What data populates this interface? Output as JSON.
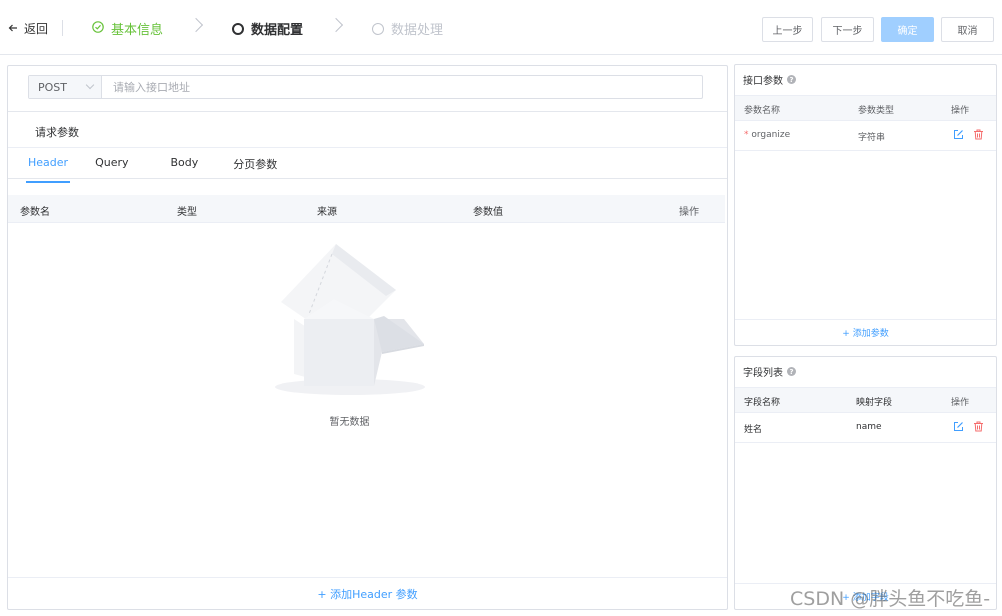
{
  "header": {
    "back_label": "返回",
    "steps": [
      {
        "label": "基本信息",
        "state": "done"
      },
      {
        "label": "数据配置",
        "state": "active"
      },
      {
        "label": "数据处理",
        "state": "todo"
      }
    ],
    "buttons": {
      "prev": "上一步",
      "next": "下一步",
      "confirm": "确定",
      "cancel": "取消"
    }
  },
  "request": {
    "method": "POST",
    "url_placeholder": "请输入接口地址",
    "url_value": "",
    "section_title": "请求参数",
    "tabs": [
      "Header",
      "Query",
      "Body",
      "分页参数"
    ],
    "active_tab": "Header",
    "columns": [
      "参数名",
      "类型",
      "来源",
      "参数值",
      "操作"
    ],
    "empty_text": "暂无数据",
    "add_label": "+ 添加Header 参数"
  },
  "interface_params": {
    "title": "接口参数",
    "columns": [
      "参数名称",
      "参数类型",
      "操作"
    ],
    "rows": [
      {
        "required_mark": "*",
        "name": "organize",
        "type": "字符串"
      }
    ],
    "add_label": "+ 添加参数"
  },
  "field_list": {
    "title": "字段列表",
    "columns": [
      "字段名称",
      "映射字段",
      "操作"
    ],
    "rows": [
      {
        "name": "姓名",
        "mapping": "name"
      }
    ],
    "add_label": "+ 添加字段"
  },
  "watermark": "CSDN @胖头鱼不吃鱼-",
  "colors": {
    "primary": "#409eff",
    "success": "#67c23a",
    "danger": "#f56c6c",
    "disabled_primary": "#a0cfff"
  }
}
